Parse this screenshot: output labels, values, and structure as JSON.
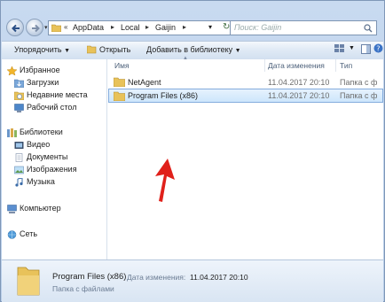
{
  "address": {
    "prefix": "«",
    "crumbs": [
      "AppData",
      "Local",
      "Gaijin"
    ],
    "search_placeholder": "Поиск: Gaijin"
  },
  "toolbar": {
    "organize": "Упорядочить",
    "open": "Открыть",
    "add_to_library": "Добавить в библиотеку"
  },
  "sidebar": {
    "favorites": "Избранное",
    "downloads": "Загрузки",
    "recent": "Недавние места",
    "desktop": "Рабочий стол",
    "libraries": "Библиотеки",
    "video": "Видео",
    "documents": "Документы",
    "images": "Изображения",
    "music": "Музыка",
    "computer": "Компьютер",
    "network": "Сеть"
  },
  "columns": {
    "name": "Имя",
    "date": "Дата изменения",
    "type": "Тип"
  },
  "rows": [
    {
      "name": "NetAgent",
      "date": "11.04.2017 20:10",
      "type": "Папка с ф"
    },
    {
      "name": "Program Files (x86)",
      "date": "11.04.2017 20:10",
      "type": "Папка с ф"
    }
  ],
  "details": {
    "name": "Program Files (x86)",
    "date_label": "Дата изменения:",
    "date_value": "11.04.2017 20:10",
    "type": "Папка с файлами"
  },
  "colors": {
    "selection": "#cde6fc",
    "arrow": "#e0201a",
    "folder": "#e8c25a"
  }
}
